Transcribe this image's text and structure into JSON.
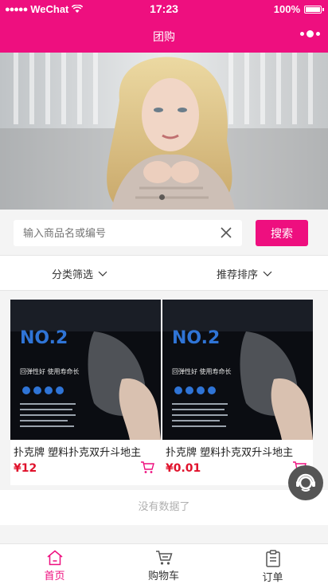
{
  "status_bar": {
    "carrier": "WeChat",
    "signal_dots": "●●●●●",
    "time": "17:23",
    "battery": "100%"
  },
  "nav": {
    "title": "团购"
  },
  "search": {
    "placeholder": "输入商品名或编号",
    "button_label": "搜索"
  },
  "filters": [
    {
      "label": "分类筛选"
    },
    {
      "label": "推荐排序"
    }
  ],
  "products": [
    {
      "title": "扑克牌 塑料扑克双升斗地主",
      "price": "¥12",
      "image_text": "NO.2",
      "image_sub": "回弹性好 使用寿命长"
    },
    {
      "title": "扑克牌 塑料扑克双升斗地主",
      "price": "¥0.01",
      "image_text": "NO.2",
      "image_sub": "回弹性好 使用寿命长"
    }
  ],
  "list_end_text": "没有数据了",
  "tabs": [
    {
      "label": "首页",
      "icon": "home-icon",
      "active": true
    },
    {
      "label": "购物车",
      "icon": "cart-icon",
      "active": false
    },
    {
      "label": "订单",
      "icon": "order-icon",
      "active": false
    }
  ],
  "colors": {
    "brand": "#ee0f7f",
    "price": "#e0112b"
  }
}
